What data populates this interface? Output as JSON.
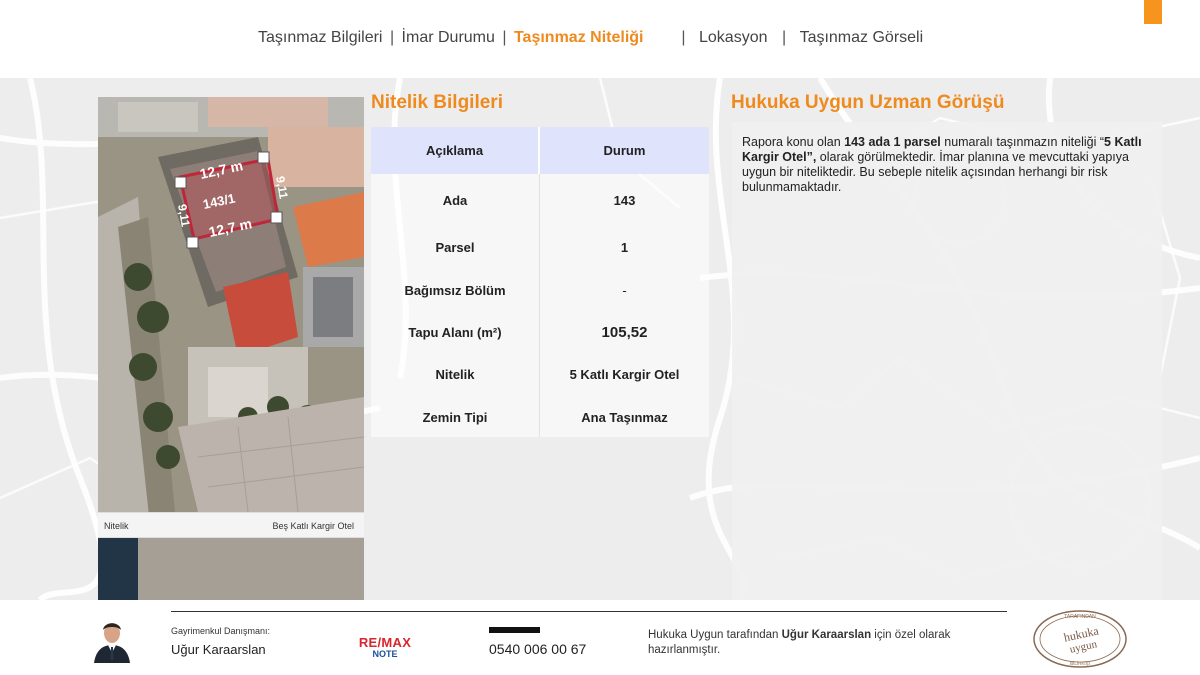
{
  "nav": {
    "item1": "Taşınmaz Bilgileri",
    "item2": "İmar Durumu",
    "item3": "Taşınmaz Niteliği",
    "item4": "Lokasyon",
    "item5": "Taşınmaz Görseli",
    "separator": "|"
  },
  "photo": {
    "labels": {
      "top": "12,7 m",
      "bottom": "12,7 m",
      "left": "9,11",
      "right": "9,11",
      "parcel": "143/1"
    },
    "caption_left": "Nitelik",
    "caption_right": "Beş Katlı Kargir Otel"
  },
  "nitelik": {
    "title": "Nitelik Bilgileri",
    "headers": [
      "Açıklama",
      "Durum"
    ],
    "rows": [
      {
        "label": "Ada",
        "value": "143"
      },
      {
        "label": "Parsel",
        "value": "1"
      },
      {
        "label": "Bağımsız Bölüm",
        "value": "-"
      },
      {
        "label": "Tapu Alanı (m²)",
        "value": "105,52"
      },
      {
        "label": "Nitelik",
        "value": "5 Katlı Kargir Otel"
      },
      {
        "label": "Zemin Tipi",
        "value": "Ana Taşınmaz"
      }
    ]
  },
  "opinion": {
    "title": "Hukuka Uygun Uzman Görüşü",
    "text_pre": "Rapora konu olan ",
    "text_bold1": "143 ada 1 parsel",
    "text_mid": " numaralı taşınmazın niteliği “",
    "text_bold2": "5 Katlı Kargir Otel”,",
    "text_post": " olarak görülmektedir. İmar planına ve mevcuttaki yapıya uygun bir niteliktedir. Bu sebeple nitelik açısından herhangi bir risk bulunmamaktadır."
  },
  "footer": {
    "consultant_label": "Gayrimenkul Danışmanı:",
    "consultant_name": "Uğur Karaarslan",
    "brand_main": "RE/MAX",
    "brand_sub": "NOTE",
    "phone": "0540 006 00 67",
    "note_pre": "Hukuka Uygun tarafından ",
    "note_bold": "Uğur Karaarslan",
    "note_post": "  için özel olarak hazırlanmıştır.",
    "seal_top": "TARAFINDAN",
    "seal_main1": "hukuka",
    "seal_main2": "uygun",
    "seal_bottom": "BİLİRKİŞİ"
  },
  "colors": {
    "accent": "#ef8a1e",
    "header_row": "#dfe3fb",
    "remax_red": "#d9262e",
    "remax_blue": "#1b4fa0"
  }
}
